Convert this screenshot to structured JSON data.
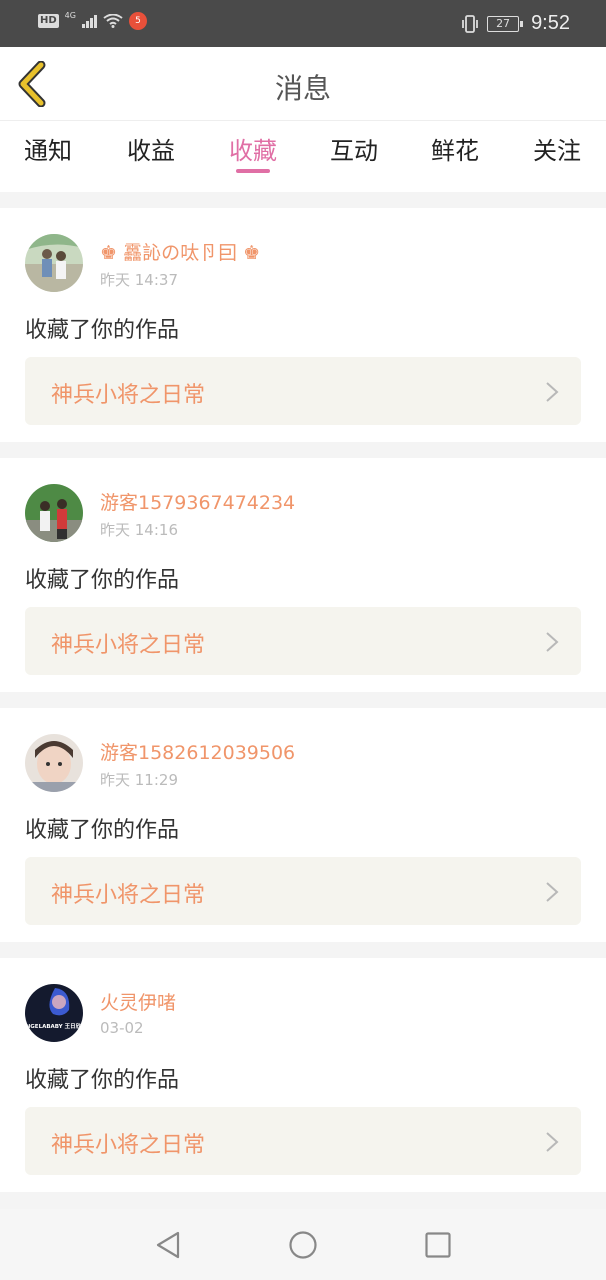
{
  "status_bar": {
    "hd": "HD",
    "network": "4G",
    "notification_badge": "5",
    "battery": "27",
    "time": "9:52"
  },
  "header": {
    "title": "消息"
  },
  "tabs": [
    {
      "label": "通知",
      "active": false
    },
    {
      "label": "收益",
      "active": false
    },
    {
      "label": "收藏",
      "active": true
    },
    {
      "label": "互动",
      "active": false
    },
    {
      "label": "鲜花",
      "active": false
    },
    {
      "label": "关注",
      "active": false
    }
  ],
  "messages": [
    {
      "username": "♚ 靐訫の呔卪囙 ♚",
      "time": "昨天 14:37",
      "action": "收藏了你的作品",
      "work_title": "神兵小将之日常"
    },
    {
      "username": "游客1579367474234",
      "time": "昨天 14:16",
      "action": "收藏了你的作品",
      "work_title": "神兵小将之日常"
    },
    {
      "username": "游客1582612039506",
      "time": "昨天 11:29",
      "action": "收藏了你的作品",
      "work_title": "神兵小将之日常"
    },
    {
      "username": "火灵伊啫",
      "time": "03-02",
      "action": "收藏了你的作品",
      "work_title": "神兵小将之日常",
      "avatar_text": "ANGELABABY 王日欣乐"
    }
  ],
  "colors": {
    "accent": "#e06fa5",
    "username": "#f0956a",
    "back_icon": "#e8c12c"
  }
}
